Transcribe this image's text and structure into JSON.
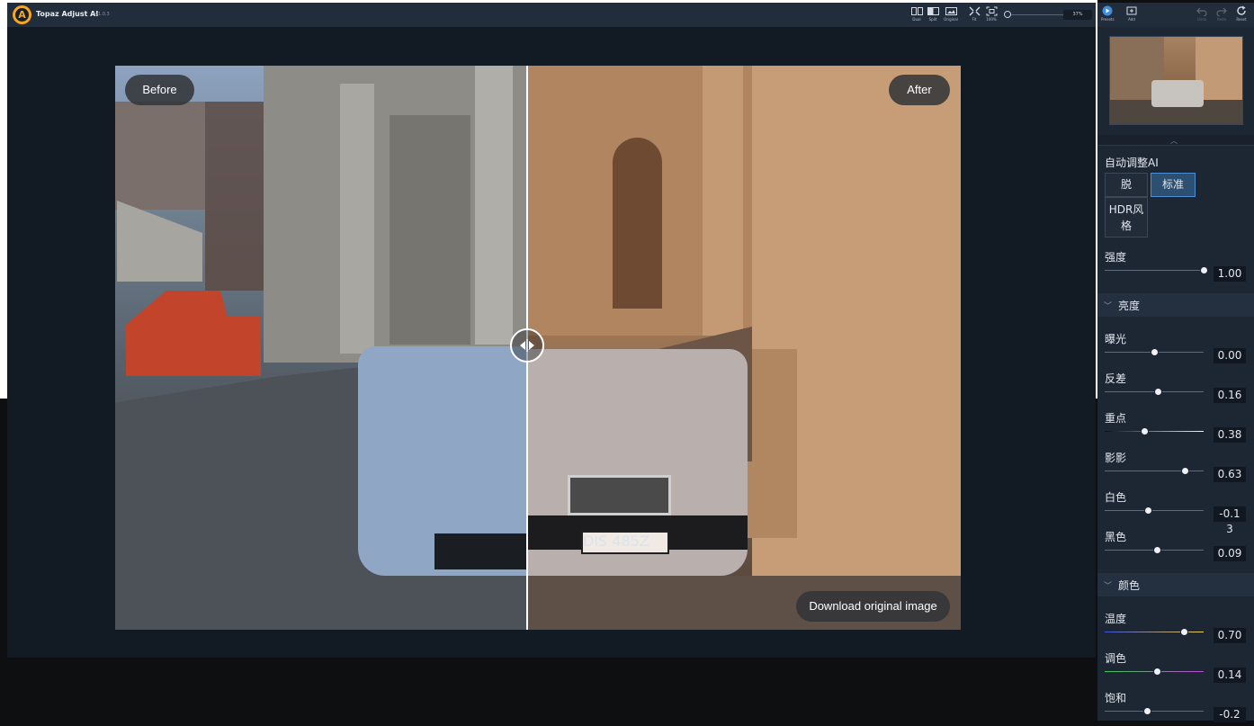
{
  "app": {
    "title": "Topaz Adjust AI",
    "version": "v1.0.3"
  },
  "toolbar": {
    "dual": "Dual",
    "split": "Split",
    "original": "Original",
    "fit": "Fit",
    "zoom100": "100%",
    "zoom_value": "37%"
  },
  "panel_toolbar": {
    "presets": "Presets",
    "add": "Add",
    "undo": "Undo",
    "redo": "Redo",
    "reset": "Reset"
  },
  "canvas": {
    "before_label": "Before",
    "after_label": "After",
    "download_label": "Download original image"
  },
  "image": {
    "plate_text": "DIS 485Z"
  },
  "auto_adjust": {
    "title": "自动调整AI",
    "modes": [
      {
        "label": "脱",
        "active": false
      },
      {
        "label": "标准",
        "active": true
      },
      {
        "label": "HDR风格",
        "line1": "HDR风",
        "line2": "格",
        "active": false
      }
    ],
    "strength": {
      "label": "强度",
      "value": "1.00",
      "level": 1.0
    }
  },
  "sections": {
    "brightness": {
      "title": "亮度",
      "sliders": [
        {
          "label": "曝光",
          "value": "0.00",
          "level": 0.5
        },
        {
          "label": "反差",
          "value": "0.16",
          "level": 0.54
        },
        {
          "label": "重点",
          "value": "0.38",
          "level": 0.4
        },
        {
          "label": "影影",
          "value": "0.63",
          "level": 0.81
        },
        {
          "label": "白色",
          "value": "-0.13",
          "value_line1": "-0.1",
          "value_line2": "3",
          "level": 0.44
        },
        {
          "label": "黑色",
          "value": "0.09",
          "level": 0.53
        }
      ]
    },
    "color": {
      "title": "颜色",
      "sliders": [
        {
          "label": "温度",
          "value": "0.70",
          "level": 0.8
        },
        {
          "label": "调色",
          "value": "0.14",
          "level": 0.53
        },
        {
          "label": "饱和",
          "value": "-0.2",
          "level": 0.43
        }
      ]
    }
  },
  "colors": {
    "accent": "#4a8ed3",
    "panel": "#1d2733",
    "topbar": "#222d3c",
    "logo": "#f5a623"
  }
}
